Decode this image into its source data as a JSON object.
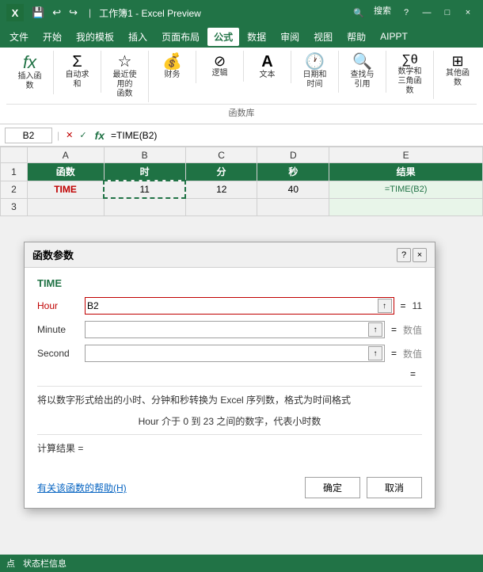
{
  "titleBar": {
    "appName": "工作簿1 - Excel Preview",
    "logo": "X",
    "windowControls": [
      "?",
      "—",
      "□",
      "×"
    ]
  },
  "quickAccess": {
    "buttons": [
      "↩",
      "↪",
      "💾"
    ]
  },
  "menuBar": {
    "items": [
      "文件",
      "开始",
      "我的模板",
      "插入",
      "页面布局",
      "公式",
      "数据",
      "审阅",
      "视图",
      "帮助",
      "AIPPT"
    ],
    "activeItem": "公式"
  },
  "ribbon": {
    "groups": [
      {
        "id": "fx",
        "label": "",
        "buttons": [
          {
            "icon": "fx",
            "label": "插入函数"
          }
        ]
      },
      {
        "id": "autosum",
        "label": "",
        "buttons": [
          {
            "icon": "Σ",
            "label": "自动求和"
          }
        ]
      },
      {
        "id": "recent",
        "label": "",
        "buttons": [
          {
            "icon": "☆",
            "label": "最近使用的\n函数"
          }
        ]
      },
      {
        "id": "finance",
        "label": "",
        "buttons": [
          {
            "icon": "💰",
            "label": "财务"
          }
        ]
      },
      {
        "id": "logic",
        "label": "",
        "buttons": [
          {
            "icon": "?",
            "label": "逻辑"
          }
        ]
      },
      {
        "id": "text",
        "label": "",
        "buttons": [
          {
            "icon": "A",
            "label": "文本"
          }
        ]
      },
      {
        "id": "datetime",
        "label": "",
        "buttons": [
          {
            "icon": "🕐",
            "label": "日期和时间"
          }
        ]
      },
      {
        "id": "lookup",
        "label": "",
        "buttons": [
          {
            "icon": "🔍",
            "label": "查找与引用"
          }
        ]
      },
      {
        "id": "math",
        "label": "",
        "buttons": [
          {
            "icon": "∑θ",
            "label": "数学和\n三角函数"
          }
        ]
      },
      {
        "id": "other",
        "label": "",
        "buttons": [
          {
            "icon": "⊞",
            "label": "其他函数"
          }
        ]
      }
    ],
    "groupLabel": "函数库"
  },
  "formulaBar": {
    "cellRef": "B2",
    "formula": "=TIME(B2)",
    "fxLabel": "fx",
    "icons": [
      "✕",
      "✓"
    ]
  },
  "spreadsheet": {
    "colHeaders": [
      "",
      "A",
      "B",
      "C",
      "D",
      "E"
    ],
    "rows": [
      {
        "rowNum": "1",
        "cells": [
          "函数",
          "时",
          "分",
          "秒",
          "结果"
        ],
        "isHeader": true
      },
      {
        "rowNum": "2",
        "cells": [
          "TIME",
          "11",
          "12",
          "40",
          "=TIME(B2)"
        ],
        "isBold": true
      }
    ]
  },
  "dialog": {
    "title": "函数参数",
    "controls": [
      "?",
      "×"
    ],
    "funcName": "TIME",
    "params": [
      {
        "label": "Hour",
        "value": "B2",
        "result": "11",
        "active": true
      },
      {
        "label": "Minute",
        "value": "",
        "result": "数值",
        "active": false
      },
      {
        "label": "Second",
        "value": "",
        "result": "数值",
        "active": false
      }
    ],
    "resultLabel": "=",
    "description": "将以数字形式给出的小时、分钟和秒转换为 Excel 序列数，格式为时间格式",
    "paramDesc": "Hour  介于 0 到 23 之间的数字，代表小时数",
    "calcResult": "计算结果 =",
    "helpLink": "有关该函数的帮助(H)",
    "okLabel": "确定",
    "cancelLabel": "取消"
  },
  "statusBar": {
    "items": [
      "点",
      "状态栏信息"
    ]
  }
}
